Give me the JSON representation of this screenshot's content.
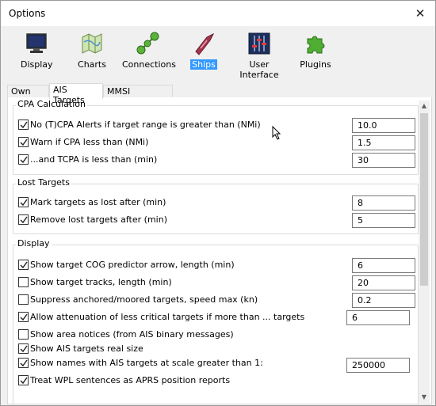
{
  "window": {
    "title": "Options"
  },
  "toolbar": {
    "items": [
      {
        "label": "Display",
        "icon": "monitor-icon"
      },
      {
        "label": "Charts",
        "icon": "charts-icon"
      },
      {
        "label": "Connections",
        "icon": "connections-icon"
      },
      {
        "label": "Ships",
        "icon": "ship-icon"
      },
      {
        "label": "User Interface",
        "icon": "sliders-icon"
      },
      {
        "label": "Plugins",
        "icon": "puzzle-icon"
      }
    ],
    "active": "Ships"
  },
  "tabs": [
    "Own Ship",
    "AIS Targets",
    "MMSI Properties"
  ],
  "active_tab": "AIS Targets",
  "cpa": {
    "title": "CPA Calculation",
    "rows": [
      {
        "label": "No (T)CPA Alerts if target range is greater than (NMi)",
        "checked": true,
        "value": "10.0"
      },
      {
        "label": "Warn if CPA less than (NMi)",
        "checked": true,
        "value": "1.5"
      },
      {
        "label": "...and TCPA is less than (min)",
        "checked": true,
        "value": "30"
      }
    ]
  },
  "lost": {
    "title": "Lost Targets",
    "rows": [
      {
        "label": "Mark targets as lost after (min)",
        "checked": true,
        "value": "8"
      },
      {
        "label": "Remove lost targets after (min)",
        "checked": true,
        "value": "5"
      }
    ]
  },
  "display": {
    "title": "Display",
    "rows": [
      {
        "label": "Show target COG predictor arrow, length (min)",
        "checked": true,
        "value": "6"
      },
      {
        "label": "Show target tracks, length (min)",
        "checked": false,
        "value": "20"
      },
      {
        "label": "Suppress anchored/moored targets, speed max (kn)",
        "checked": false,
        "value": "0.2"
      },
      {
        "label": "Allow attenuation of less critical targets if more than ... targets",
        "checked": true,
        "value": "6"
      },
      {
        "label": "Show area notices (from AIS binary messages)",
        "checked": false
      },
      {
        "label": "Show AIS targets real size",
        "checked": true
      },
      {
        "label": "Show names with AIS targets at scale greater than 1:",
        "checked": true,
        "value": "250000"
      },
      {
        "label": "Treat WPL sentences as APRS position reports",
        "checked": true
      }
    ]
  }
}
